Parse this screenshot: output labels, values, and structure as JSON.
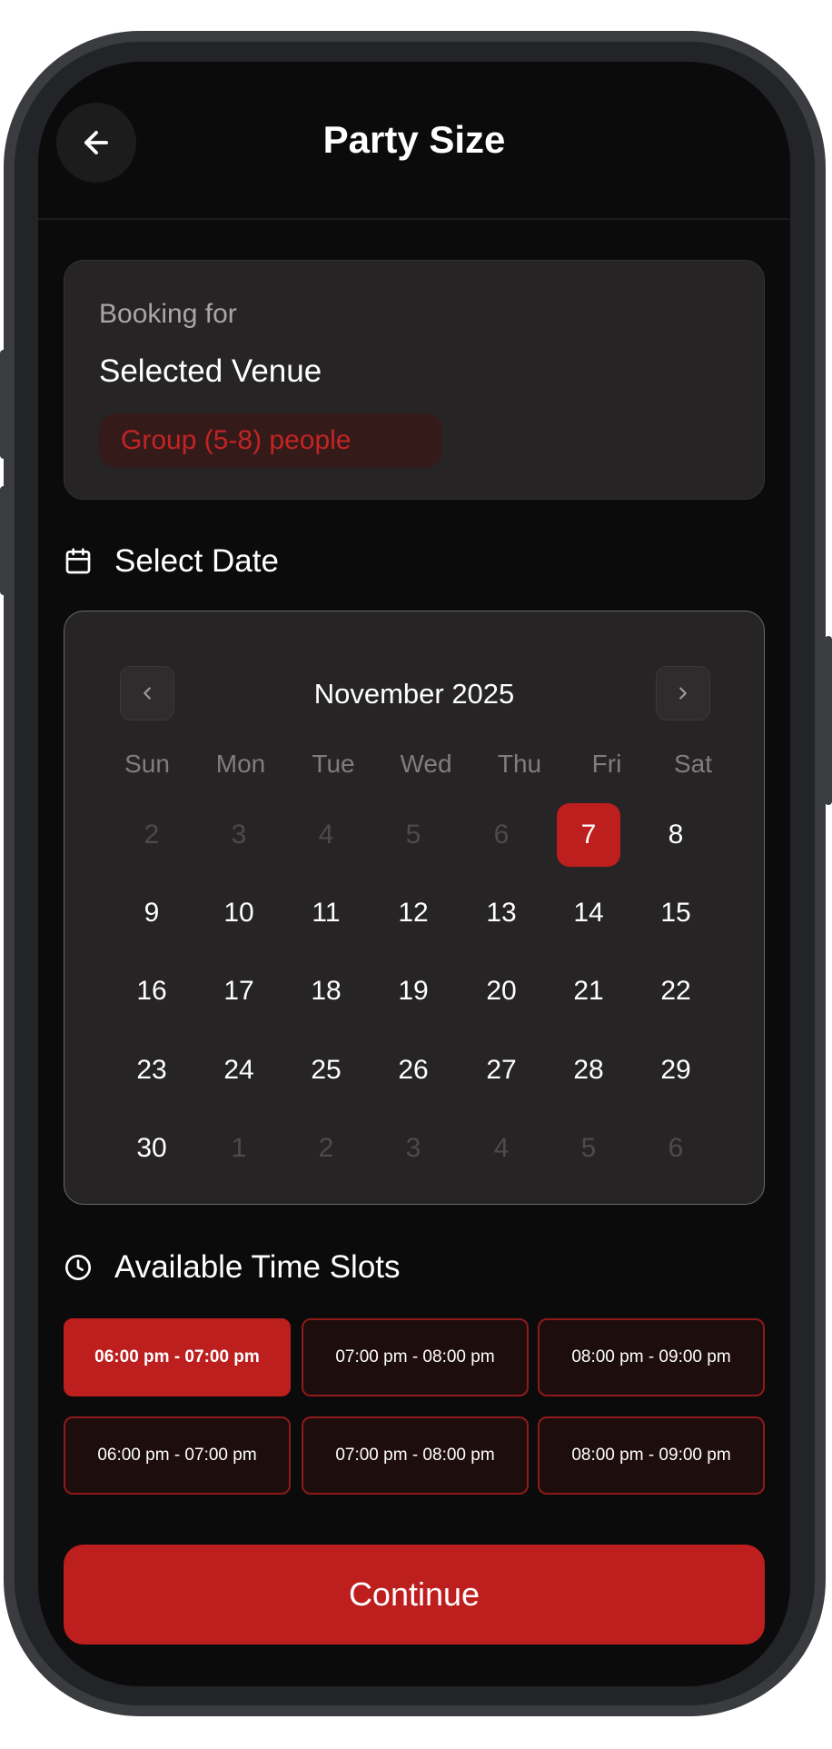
{
  "header": {
    "title": "Party Size"
  },
  "booking": {
    "label": "Booking for",
    "venue": "Selected Venue",
    "group": "Group (5-8) people"
  },
  "date_section": {
    "title": "Select Date"
  },
  "calendar": {
    "month": "November 2025",
    "weekdays": [
      "Sun",
      "Mon",
      "Tue",
      "Wed",
      "Thu",
      "Fri",
      "Sat"
    ],
    "weeks": [
      [
        "2",
        "3",
        "4",
        "5",
        "6",
        "7",
        "8"
      ],
      [
        "9",
        "10",
        "11",
        "12",
        "13",
        "14",
        "15"
      ],
      [
        "16",
        "17",
        "18",
        "19",
        "20",
        "21",
        "22"
      ],
      [
        "23",
        "24",
        "25",
        "26",
        "27",
        "28",
        "29"
      ],
      [
        "30",
        "1",
        "2",
        "3",
        "4",
        "5",
        "6"
      ]
    ],
    "selected_day": "7"
  },
  "time_section": {
    "title": "Available Time Slots"
  },
  "time_slots": [
    {
      "label": "06:00 pm - 07:00 pm",
      "selected": true
    },
    {
      "label": "07:00 pm - 08:00 pm",
      "selected": false
    },
    {
      "label": "08:00 pm - 09:00 pm",
      "selected": false
    },
    {
      "label": "06:00 pm - 07:00 pm",
      "selected": false
    },
    {
      "label": "07:00 pm - 08:00 pm",
      "selected": false
    },
    {
      "label": "08:00 pm - 09:00 pm",
      "selected": false
    }
  ],
  "continue_label": "Continue",
  "colors": {
    "accent": "#bd1e1e",
    "background": "#0b0b0b",
    "card": "#262424"
  },
  "icons": {
    "back": "arrow-left-icon",
    "calendar": "calendar-icon",
    "clock": "clock-icon",
    "prev": "chevron-left-icon",
    "next": "chevron-right-icon"
  }
}
